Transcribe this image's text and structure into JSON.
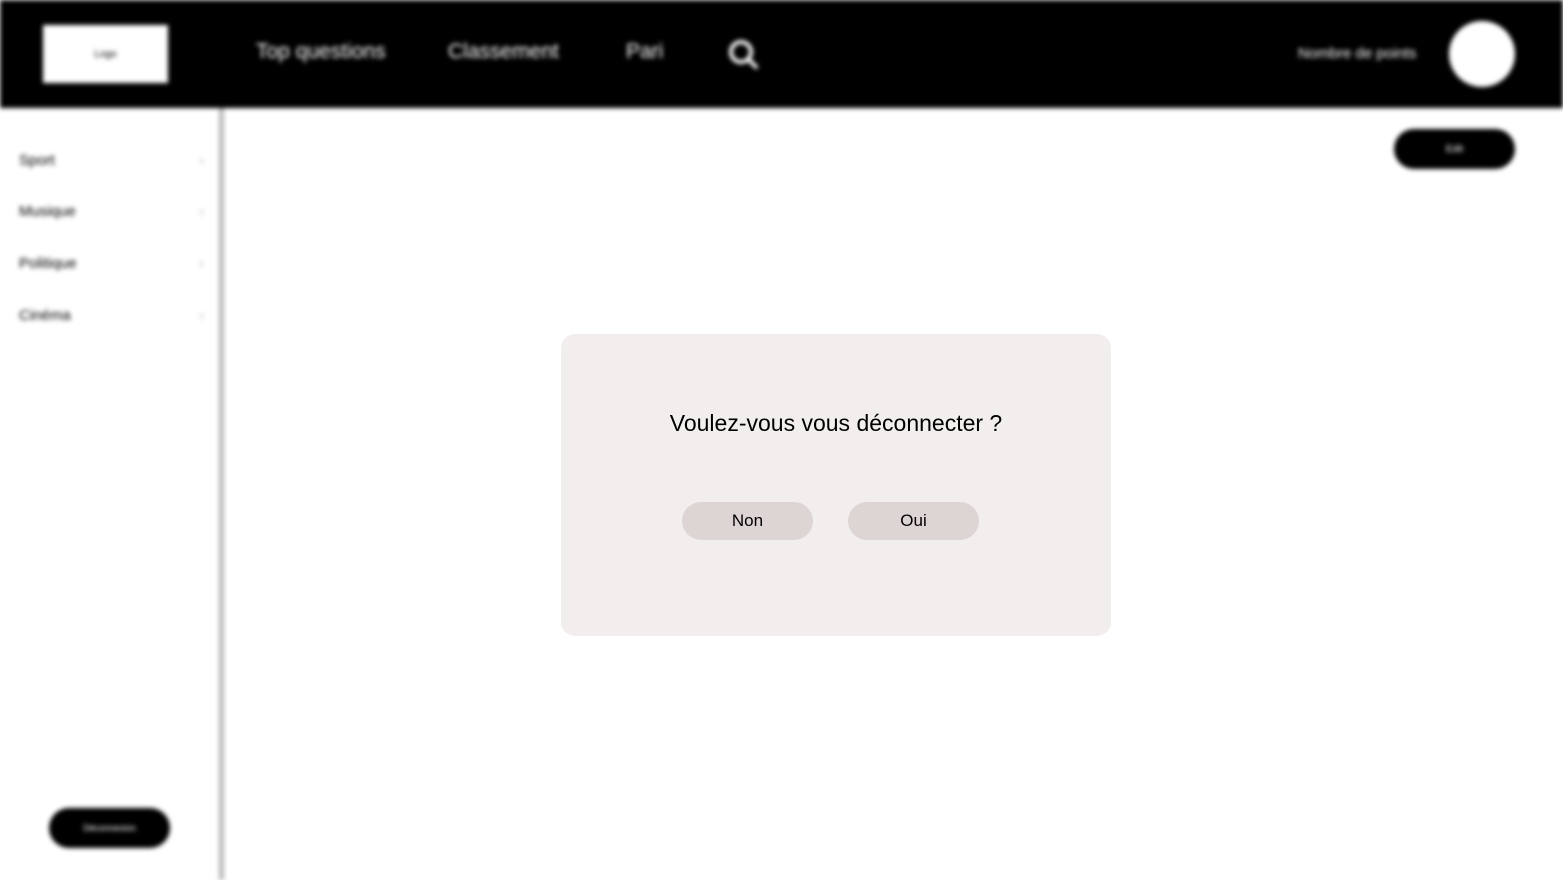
{
  "header": {
    "logo_label": "Logo",
    "nav": [
      {
        "label": "Top questions"
      },
      {
        "label": "Classement"
      },
      {
        "label": "Pari"
      }
    ],
    "points_label": "Nombre de points"
  },
  "sidebar": {
    "items": [
      {
        "label": "Sport",
        "chevron": "›"
      },
      {
        "label": "Musique",
        "chevron": "›"
      },
      {
        "label": "Politique",
        "chevron": "›"
      },
      {
        "label": "Cinéma",
        "chevron": "›"
      }
    ],
    "bottom_button_label": "Déconnexion"
  },
  "main": {
    "top_right_button_label": "Edit"
  },
  "dialog": {
    "question": "Voulez-vous vous déconnecter ?",
    "no_label": "Non",
    "yes_label": "Oui"
  },
  "colors": {
    "header_bg": "#000000",
    "dialog_bg": "#f2eeed",
    "dialog_button_bg": "#ddd5d4"
  }
}
